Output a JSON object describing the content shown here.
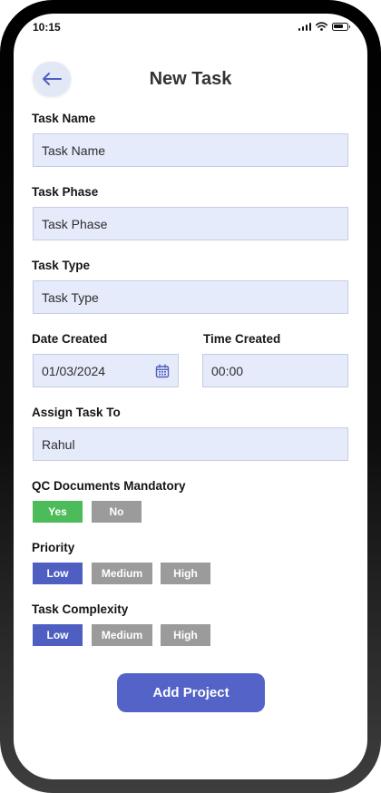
{
  "status_bar": {
    "time": "10:15"
  },
  "header": {
    "title": "New Task"
  },
  "form": {
    "task_name": {
      "label": "Task Name",
      "placeholder": "Task Name"
    },
    "task_phase": {
      "label": "Task Phase",
      "placeholder": "Task Phase"
    },
    "task_type": {
      "label": "Task Type",
      "placeholder": "Task Type"
    },
    "date_created": {
      "label": "Date Created",
      "value": "01/03/2024"
    },
    "time_created": {
      "label": "Time Created",
      "value": "00:00"
    },
    "assign_task_to": {
      "label": "Assign Task To",
      "value": "Rahul"
    },
    "qc_documents": {
      "label": "QC Documents Mandatory",
      "options": [
        "Yes",
        "No"
      ],
      "selected": "Yes"
    },
    "priority": {
      "label": "Priority",
      "options": [
        "Low",
        "Medium",
        "High"
      ],
      "selected": "Low"
    },
    "task_complexity": {
      "label": "Task Complexity",
      "options": [
        "Low",
        "Medium",
        "High"
      ],
      "selected": "Low"
    }
  },
  "submit": {
    "label": "Add Project"
  },
  "colors": {
    "accent": "#4f5fc1",
    "selected_yes": "#4cbb5a",
    "unselected": "#9b9b9b",
    "field_bg": "#e6ebfb"
  },
  "icons": {
    "back": "arrow-left-icon",
    "calendar": "calendar-icon",
    "signal": "cellular-signal-icon",
    "wifi": "wifi-icon",
    "battery": "battery-icon"
  }
}
